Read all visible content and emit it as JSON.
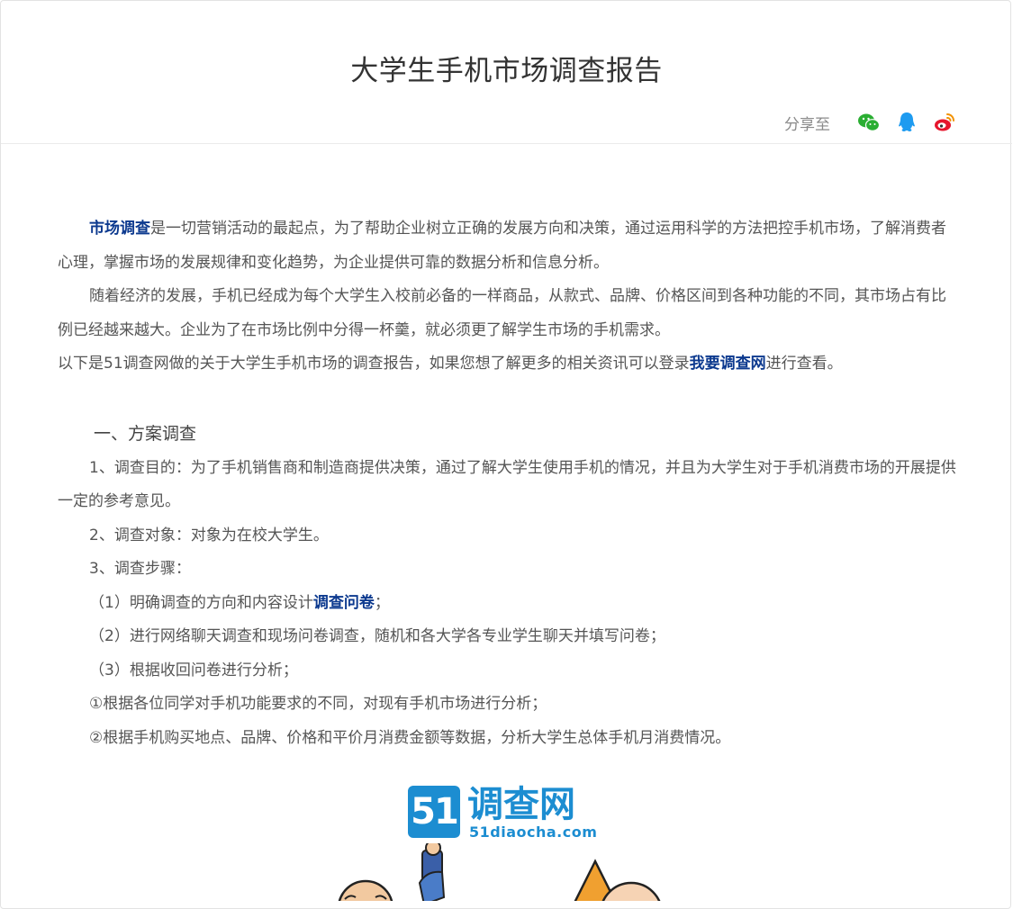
{
  "article": {
    "title": "大学生手机市场调查报告",
    "share": {
      "label": "分享至",
      "icons": [
        "wechat-icon",
        "qq-icon",
        "weibo-icon"
      ]
    },
    "intro": {
      "p1_link": "市场调查",
      "p1_text": "是一切营销活动的最起点，为了帮助企业树立正确的发展方向和决策，通过运用科学的方法把控手机市场，了解消费者心理，掌握市场的发展规律和变化趋势，为企业提供可靠的数据分析和信息分析。",
      "p2_text": "随着经济的发展，手机已经成为每个大学生入校前必备的一样商品，从款式、品牌、价格区间到各种功能的不同，其市场占有比例已经越来越大。企业为了在市场比例中分得一杯羹，就必须更了解学生市场的手机需求。",
      "p3_before": "以下是51调查网做的关于大学生手机市场的调查报告，如果您想了解更多的相关资讯可以登录",
      "p3_link": "我要调查网",
      "p3_after": "进行查看。"
    },
    "section1": {
      "heading": "一、方案调查",
      "purpose": "1、调查目的：为了手机销售商和制造商提供决策，通过了解大学生使用手机的情况，并且为大学生对于手机消费市场的开展提供一定的参考意见。",
      "target": "2、调查对象：对象为在校大学生。",
      "steps_heading": "3、调查步骤：",
      "step1_before": "（1）明确调查的方向和内容设计",
      "step1_link": "调查问卷",
      "step1_after": "；",
      "step2": "（2）进行网络聊天调查和现场问卷调查，随机和各大学各专业学生聊天并填写问卷；",
      "step3": "（3）根据收回问卷进行分析；",
      "sub1": "①根据各位同学对手机功能要求的不同，对现有手机市场进行分析；",
      "sub2": "②根据手机购买地点、品牌、价格和平价月消费金额等数据，分析大学生总体手机月消费情况。"
    }
  },
  "banner": {
    "logo_number": "51",
    "logo_name": "调查网",
    "logo_domain": "51diaocha.com"
  },
  "colors": {
    "link": "#0d3a8f",
    "text": "#555555",
    "title": "#333333",
    "wechat": "#2aae32",
    "qq": "#1e9bf0",
    "weibo": "#e6162d",
    "logo_blue": "#1c8dd1"
  }
}
